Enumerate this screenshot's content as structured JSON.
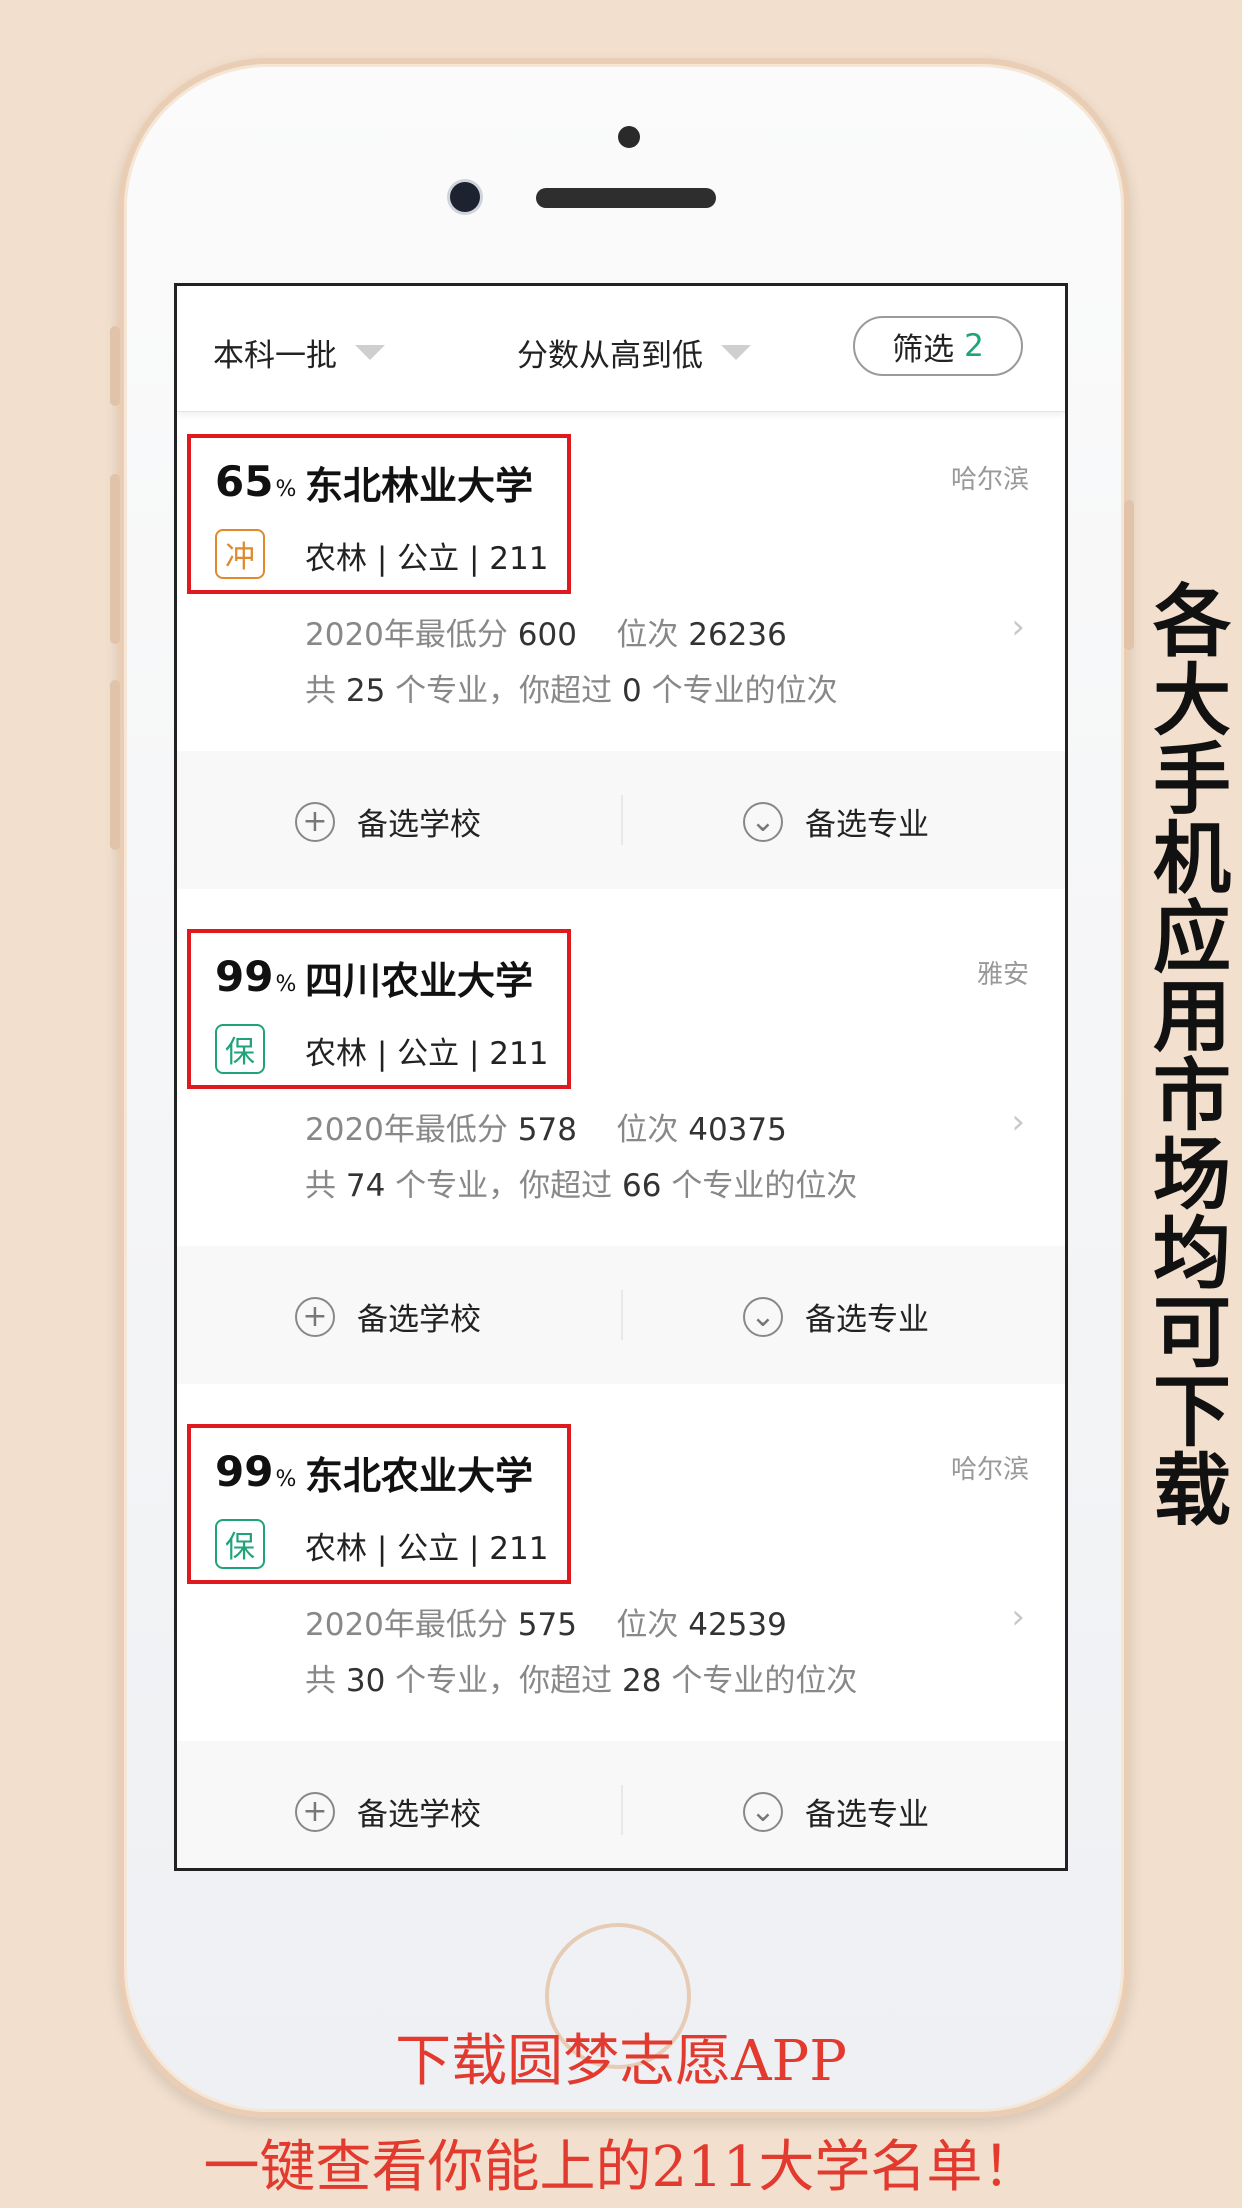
{
  "filter_bar": {
    "batch": "本科一批",
    "sort": "分数从高到低",
    "filter_label": "筛选",
    "filter_count": "2"
  },
  "cards": [
    {
      "pct": "65",
      "pct_unit": "%",
      "name": "东北林业大学",
      "tag": "冲",
      "info": "农林 | 公立 | 211",
      "city": "哈尔滨",
      "year_label": "2020年最低分",
      "min_score": "600",
      "rank_label": "位次",
      "rank": "26236",
      "majors_pre": "共",
      "majors_total": "25",
      "majors_mid": "个专业，你超过",
      "majors_over": "0",
      "majors_post": "个专业的位次",
      "action_school": "备选学校",
      "action_major": "备选专业"
    },
    {
      "pct": "99",
      "pct_unit": "%",
      "name": "四川农业大学",
      "tag": "保",
      "info": "农林 | 公立 | 211",
      "city": "雅安",
      "year_label": "2020年最低分",
      "min_score": "578",
      "rank_label": "位次",
      "rank": "40375",
      "majors_pre": "共",
      "majors_total": "74",
      "majors_mid": "个专业，你超过",
      "majors_over": "66",
      "majors_post": "个专业的位次",
      "action_school": "备选学校",
      "action_major": "备选专业"
    },
    {
      "pct": "99",
      "pct_unit": "%",
      "name": "东北农业大学",
      "tag": "保",
      "info": "农林 | 公立 | 211",
      "city": "哈尔滨",
      "year_label": "2020年最低分",
      "min_score": "575",
      "rank_label": "位次",
      "rank": "42539",
      "majors_pre": "共",
      "majors_total": "30",
      "majors_mid": "个专业，你超过",
      "majors_over": "28",
      "majors_post": "个专业的位次",
      "action_school": "备选学校",
      "action_major": "备选专业"
    }
  ],
  "promo": {
    "side": "各大手机应用市场均可下载",
    "line1": "下载圆梦志愿APP",
    "line2": "一键查看你能上的211大学名单！"
  },
  "colors": {
    "accent_green": "#1fa37a",
    "tag_orange": "#e0892c",
    "highlight_red": "#e0191e",
    "promo_red": "#e23a2e"
  },
  "icons": [
    "add-circle-icon",
    "chevron-down-circle-icon",
    "chevron-right-icon",
    "dropdown-caret-icon"
  ]
}
